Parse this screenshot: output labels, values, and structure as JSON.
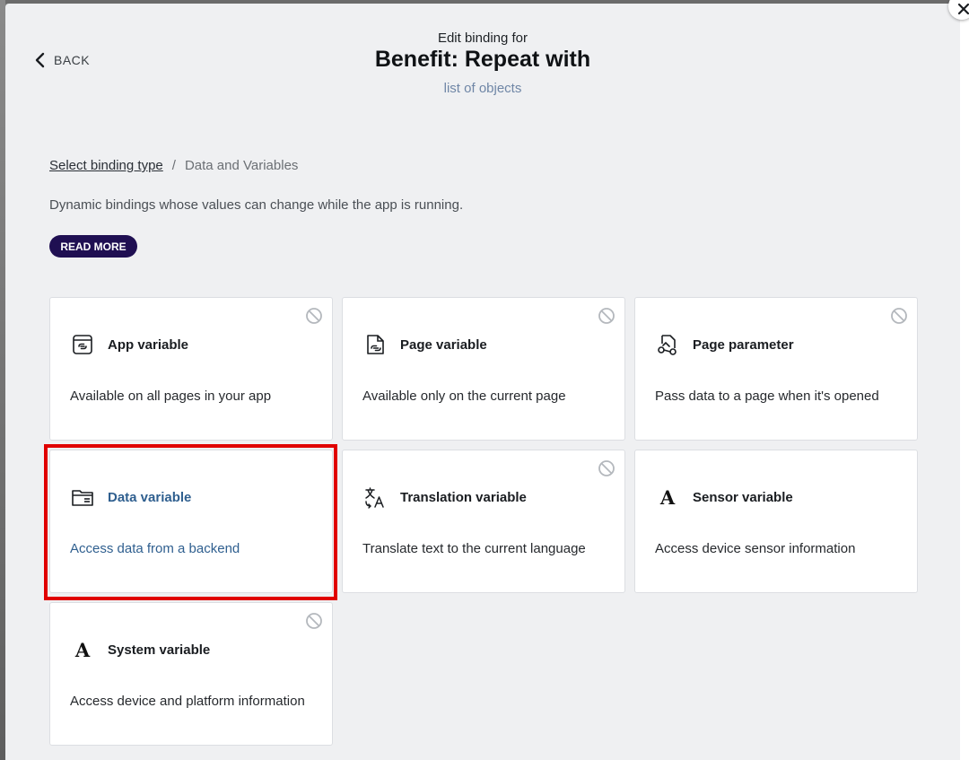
{
  "header": {
    "back_label": "BACK",
    "subtitle": "Edit binding for",
    "title": "Benefit: Repeat with",
    "description": "list of objects"
  },
  "breadcrumb": {
    "link": "Select binding type",
    "separator": "/",
    "current": "Data and Variables"
  },
  "intro": "Dynamic bindings whose values can change while the app is running.",
  "read_more_label": "READ MORE",
  "colors": {
    "read_more_bg": "#1f0f52",
    "active_text": "#2f5f8f",
    "highlight": "#e00000"
  },
  "cards": [
    {
      "title": "App variable",
      "description": "Available on all pages in your app",
      "icon": "app-variable-icon",
      "disabled": true
    },
    {
      "title": "Page variable",
      "description": "Available only on the current page",
      "icon": "page-variable-icon",
      "disabled": true
    },
    {
      "title": "Page parameter",
      "description": "Pass data to a page when it's opened",
      "icon": "page-parameter-icon",
      "disabled": true
    },
    {
      "title": "Data variable",
      "description": "Access data from a backend",
      "icon": "folder-icon",
      "disabled": false,
      "selected": true
    },
    {
      "title": "Translation variable",
      "description": "Translate text to the current language",
      "icon": "translate-icon",
      "disabled": true
    },
    {
      "title": "Sensor variable",
      "description": "Access device sensor information",
      "icon": "serif-a-icon",
      "icon_glyph": "A",
      "disabled": false
    },
    {
      "title": "System variable",
      "description": "Access device and platform information",
      "icon": "serif-a-icon",
      "icon_glyph": "A",
      "disabled": true
    }
  ]
}
